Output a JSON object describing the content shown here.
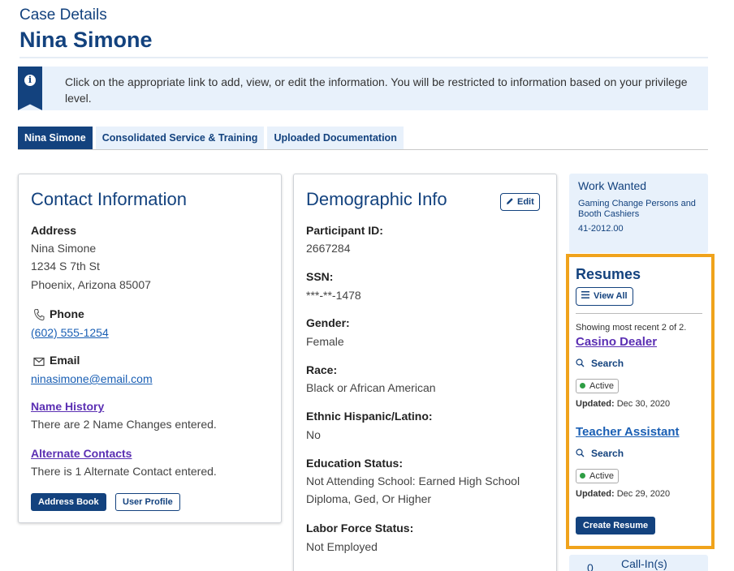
{
  "header": {
    "label": "Case Details",
    "name": "Nina Simone"
  },
  "banner": {
    "icon": "info-icon",
    "message": "Click on the appropriate link to add, view, or edit the information. You will be restricted to information based on your privilege level."
  },
  "tabs": [
    {
      "label": "Nina Simone",
      "active": true
    },
    {
      "label": "Consolidated Service & Training",
      "active": false
    },
    {
      "label": "Uploaded Documentation",
      "active": false
    }
  ],
  "contact": {
    "title": "Contact Information",
    "address_label": "Address",
    "address_lines": [
      "Nina Simone",
      "1234 S 7th St",
      "Phoenix, Arizona 85007"
    ],
    "phone_label": "Phone",
    "phone": "(602) 555-1254",
    "email_label": "Email",
    "email": "ninasimone@email.com",
    "name_history_link": "Name History",
    "name_history_text": "There are 2 Name Changes entered.",
    "alt_contacts_link": "Alternate Contacts",
    "alt_contacts_text": "There is 1 Alternate Contact entered.",
    "address_book_button": "Address Book",
    "user_profile_button": "User Profile"
  },
  "demographic": {
    "title": "Demographic Info",
    "edit_button": "Edit",
    "fields": [
      {
        "label": "Participant ID:",
        "value": "2667284"
      },
      {
        "label": "SSN:",
        "value": "***-**-1478"
      },
      {
        "label": "Gender:",
        "value": "Female"
      },
      {
        "label": "Race:",
        "value": "Black or African American"
      },
      {
        "label": "Ethnic Hispanic/Latino:",
        "value": "No"
      },
      {
        "label": "Education Status:",
        "value": "Not Attending School: Earned High School Diploma, Ged, Or Higher"
      },
      {
        "label": "Labor Force Status:",
        "value": "Not Employed"
      }
    ]
  },
  "work_wanted": {
    "title": "Work Wanted",
    "occupation": "Gaming Change Persons and Booth Cashiers",
    "code": "41-2012.00"
  },
  "resumes": {
    "title": "Resumes",
    "view_all": "View All",
    "showing_text": "Showing most recent 2 of 2.",
    "items": [
      {
        "title": "Casino Dealer",
        "search": "Search",
        "status": "Active",
        "updated_label": "Updated:",
        "updated_date": "Dec 30, 2020"
      },
      {
        "title": "Teacher Assistant",
        "search": "Search",
        "status": "Active",
        "updated_label": "Updated:",
        "updated_date": "Dec 29, 2020"
      }
    ],
    "create_button": "Create Resume"
  },
  "callin": {
    "count": "0",
    "label": "Call-In(s)"
  },
  "colors": {
    "primary": "#13427e",
    "light_bg": "#e8f1fb",
    "highlight": "#f0a31c",
    "link_purple": "#5b2fb3",
    "active_dot": "#2e9e44"
  }
}
